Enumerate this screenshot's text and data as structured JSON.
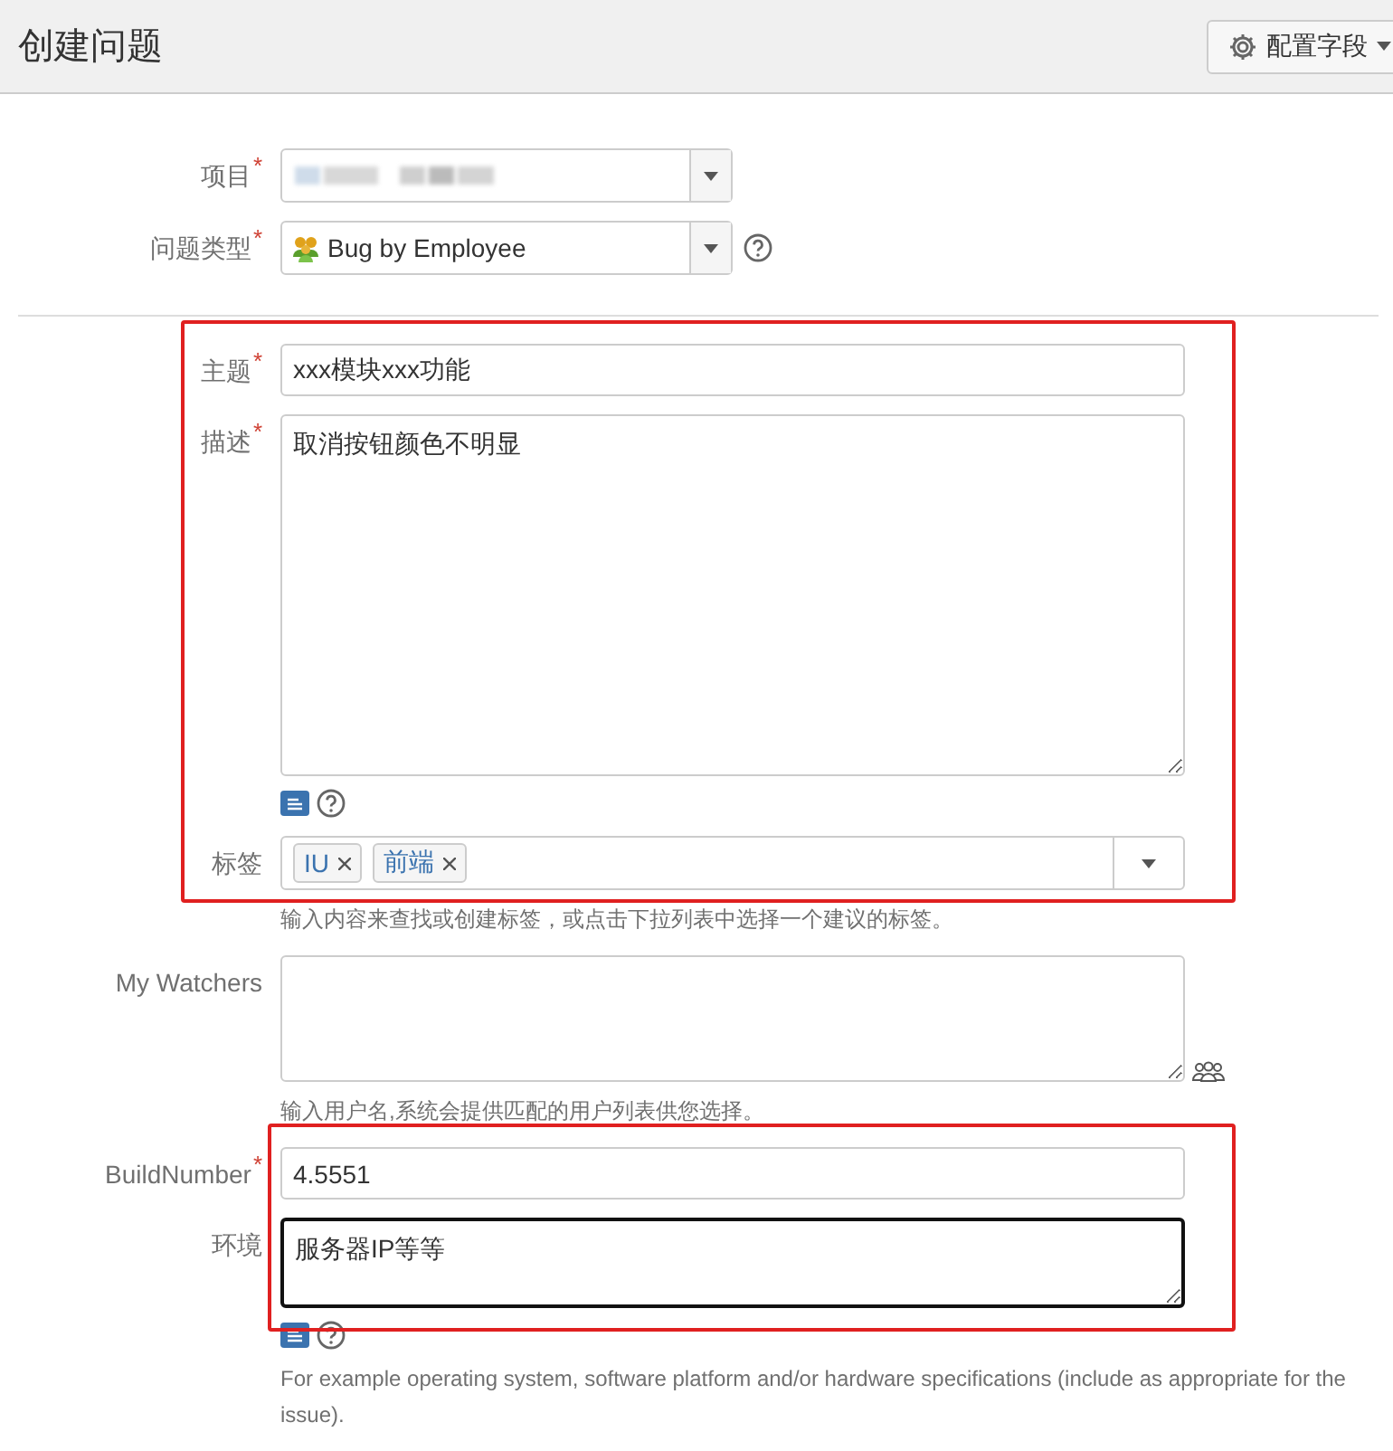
{
  "header": {
    "title": "创建问题",
    "configure_button": "配置字段"
  },
  "fields": [
    {
      "kind": "select",
      "label": "项目",
      "required_mark": "*",
      "redacted": true,
      "highlighted": false,
      "divider_after": false
    },
    {
      "kind": "select",
      "label": "问题类型",
      "required_mark": "*",
      "value": "Bug by Employee",
      "help": true,
      "highlighted": false,
      "divider_after": true
    },
    {
      "kind": "text",
      "label": "主题",
      "required_mark": "*",
      "value": "xxx模块xxx功能",
      "highlighted": true
    },
    {
      "kind": "textarea",
      "label": "描述",
      "required_mark": "*",
      "value": "取消按钮颜色不明显",
      "editor_tools": true,
      "highlighted": true
    },
    {
      "kind": "tags",
      "label": "标签",
      "tags": [
        "IU",
        "前端"
      ],
      "highlighted": true,
      "hint": "输入内容来查找或创建标签，或点击下拉列表中选择一个建议的标签。"
    },
    {
      "kind": "textarea",
      "label": "My Watchers",
      "people_picker": true,
      "highlighted": false,
      "hint": "输入用户名,系统会提供匹配的用户列表供您选择。"
    },
    {
      "kind": "text",
      "label": "BuildNumber",
      "required_mark": "*",
      "value": "4.5551",
      "highlighted": true
    },
    {
      "kind": "textarea",
      "label": "环境",
      "value": "服务器IP等等",
      "focused": true,
      "editor_tools": true,
      "highlighted": true,
      "hint": "For example operating system, software platform and/or hardware specifications (include as appropriate for the issue)."
    }
  ]
}
